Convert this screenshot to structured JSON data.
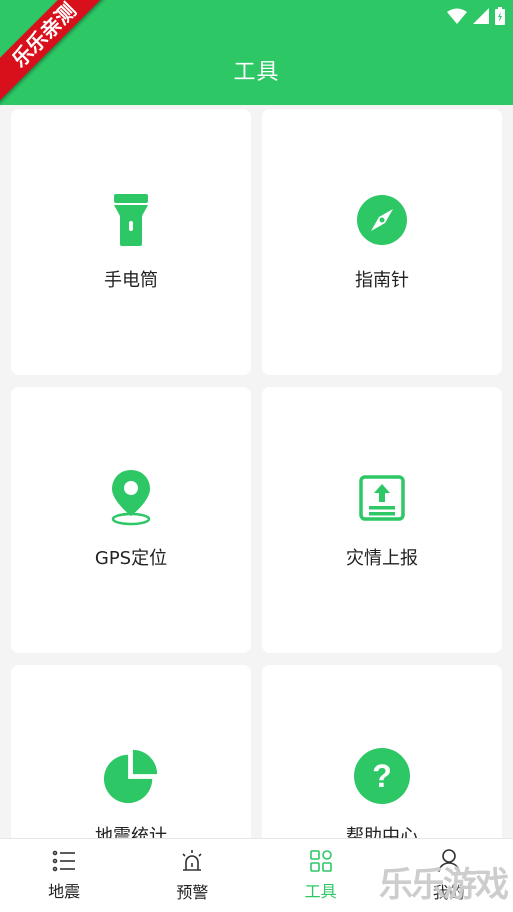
{
  "ribbon": {
    "text": "乐乐亲测"
  },
  "header": {
    "title": "工具"
  },
  "tools": [
    {
      "label": "手电筒",
      "icon": "flashlight-icon"
    },
    {
      "label": "指南针",
      "icon": "compass-icon"
    },
    {
      "label": "GPS定位",
      "icon": "location-pin-icon"
    },
    {
      "label": "灾情上报",
      "icon": "upload-report-icon"
    },
    {
      "label": "地震统计",
      "icon": "pie-chart-icon"
    },
    {
      "label": "帮助中心",
      "icon": "help-icon"
    }
  ],
  "tabbar": {
    "items": [
      {
        "label": "地震",
        "icon": "list-icon"
      },
      {
        "label": "预警",
        "icon": "alarm-icon"
      },
      {
        "label": "工具",
        "icon": "tools-grid-icon"
      },
      {
        "label": "我的",
        "icon": "user-icon"
      }
    ],
    "active": "工具"
  },
  "watermark": {
    "text": "乐乐游戏"
  },
  "colors": {
    "accent": "#2ec766",
    "ribbon": "#d8101b"
  }
}
